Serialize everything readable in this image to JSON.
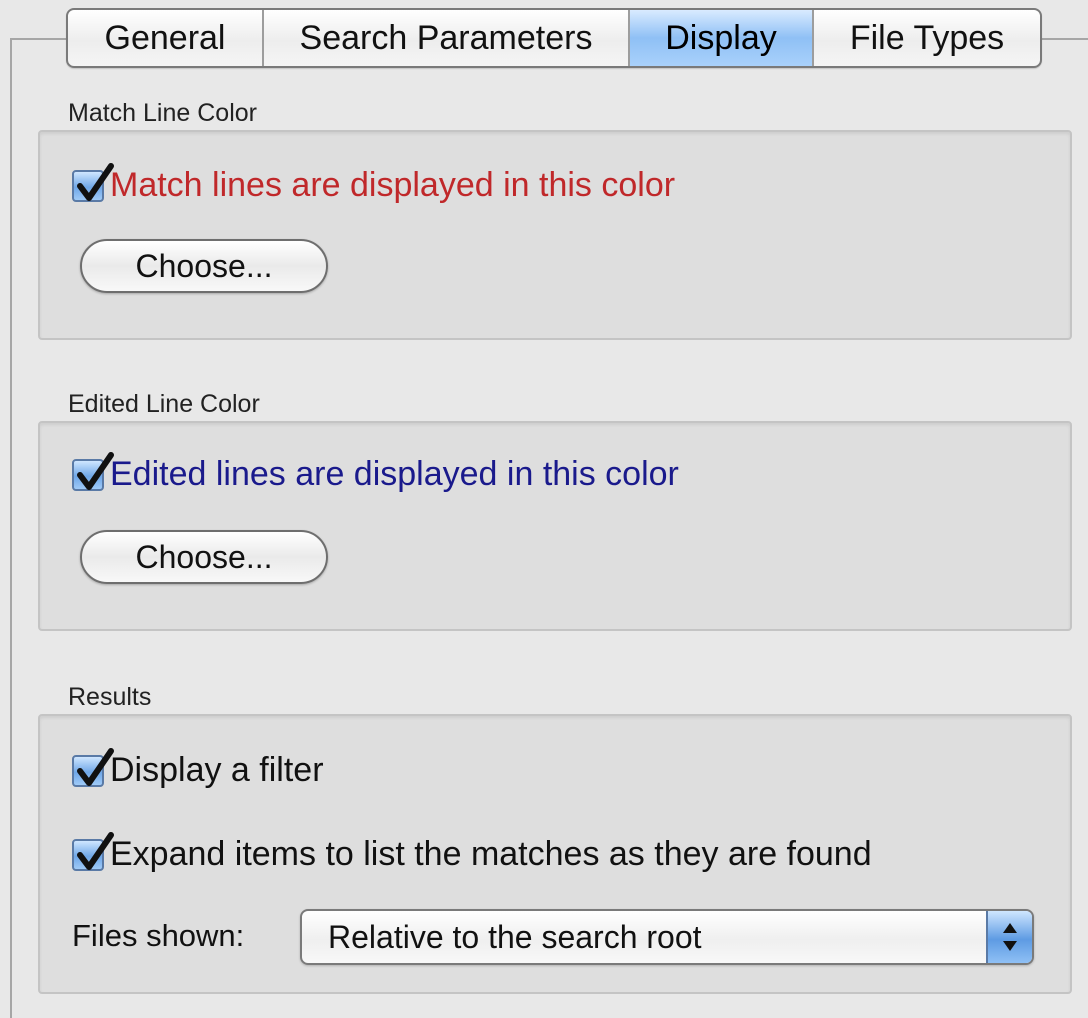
{
  "tabs": [
    {
      "label": "General",
      "active": false
    },
    {
      "label": "Search Parameters",
      "active": false
    },
    {
      "label": "Display",
      "active": true
    },
    {
      "label": "File Types",
      "active": false
    }
  ],
  "match_line_color": {
    "title": "Match Line Color",
    "checkbox_label": "Match lines are displayed in this color",
    "checked": true,
    "text_color": "#c0282a",
    "button_label": "Choose..."
  },
  "edited_line_color": {
    "title": "Edited Line Color",
    "checkbox_label": "Edited lines are displayed in this color",
    "checked": true,
    "text_color": "#1a1a8c",
    "button_label": "Choose..."
  },
  "results": {
    "title": "Results",
    "display_filter_label": "Display a filter",
    "display_filter_checked": true,
    "expand_items_label": "Expand items to list the matches as they are found",
    "expand_items_checked": true,
    "files_shown_label": "Files shown:",
    "files_shown_value": "Relative to the search root"
  },
  "icons": {
    "checkbox": "checkmark-icon",
    "popup": "updown-arrows-icon"
  },
  "colors": {
    "accent": "#6fa7e8",
    "window_bg": "#e8e8e8",
    "group_bg": "#dedede"
  }
}
